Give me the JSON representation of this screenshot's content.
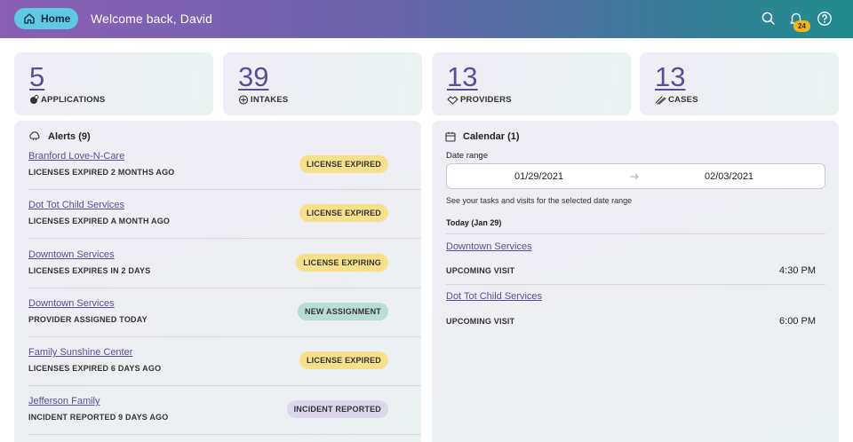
{
  "header": {
    "home_label": "Home",
    "welcome": "Welcome back, David",
    "notifications_count": "24",
    "icons": [
      "home-icon",
      "search-icon",
      "bell-icon",
      "help-icon"
    ]
  },
  "stats": [
    {
      "value": "5",
      "label": "APPLICATIONS",
      "icon": "applications-icon"
    },
    {
      "value": "39",
      "label": "INTAKES",
      "icon": "intakes-icon"
    },
    {
      "value": "13",
      "label": "PROVIDERS",
      "icon": "providers-icon"
    },
    {
      "value": "13",
      "label": "CASES",
      "icon": "cases-icon"
    }
  ],
  "alerts": {
    "title": "Alerts (9)",
    "items": [
      {
        "name": "Branford Love-N-Care",
        "detail": "LICENSES EXPIRED 2 MONTHS AGO",
        "status": "LICENSE EXPIRED",
        "color": "#f7e08a"
      },
      {
        "name": "Dot Tot Child Services",
        "detail": "LICENSES EXPIRED A MONTH AGO",
        "status": "LICENSE EXPIRED",
        "color": "#f7e08a"
      },
      {
        "name": "Downtown Services",
        "detail": "LICENSES EXPIRES IN 2 DAYS",
        "status": "LICENSE EXPIRING",
        "color": "#f7e08a"
      },
      {
        "name": "Downtown Services",
        "detail": "PROVIDER ASSIGNED TODAY",
        "status": "NEW ASSIGNMENT",
        "color": "#b8ddd5"
      },
      {
        "name": "Family Sunshine Center",
        "detail": "LICENSES EXPIRED 6 DAYS AGO",
        "status": "LICENSE EXPIRED",
        "color": "#f7e08a"
      },
      {
        "name": "Jefferson Family",
        "detail": "INCIDENT REPORTED 9 DAYS AGO",
        "status": "INCIDENT REPORTED",
        "color": "#dcd6ea"
      }
    ]
  },
  "calendar": {
    "title": "Calendar (1)",
    "date_range_label": "Date range",
    "start_date": "01/29/2021",
    "end_date": "02/03/2021",
    "helper": "See your tasks and visits for the selected date range",
    "day_heading": "Today (Jan 29)",
    "events": [
      {
        "name": "Downtown Services",
        "type": "UPCOMING VISIT",
        "time": "4:30 PM"
      },
      {
        "name": "Dot Tot Child Services",
        "type": "UPCOMING VISIT",
        "time": "6:00 PM"
      }
    ]
  }
}
